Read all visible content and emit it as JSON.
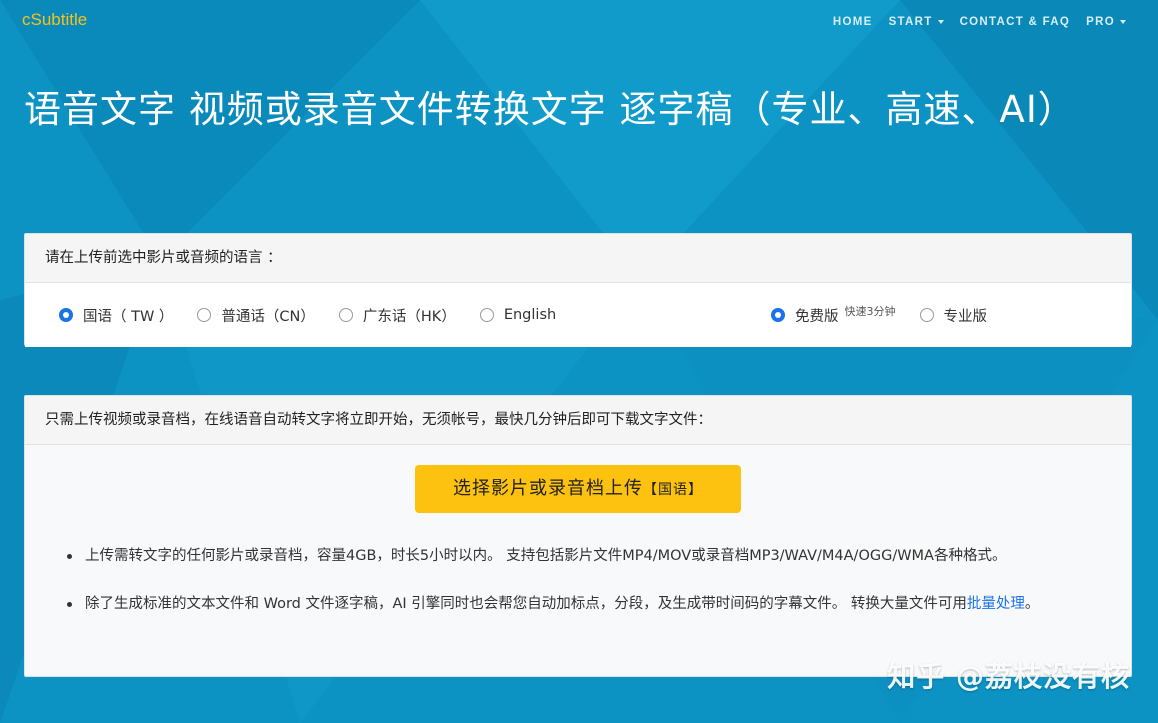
{
  "brand": "cSubtitle",
  "nav": {
    "home": "HOME",
    "start": "START",
    "contact": "CONTACT & FAQ",
    "pro": "PRO"
  },
  "hero": {
    "title": "语音文字 视频或录音文件转换文字 逐字稿（专业、高速、AI）"
  },
  "language_card": {
    "heading": "请在上传前选中影片或音频的语言 ：",
    "languages": [
      {
        "label": "国语（ TW ）",
        "selected": true
      },
      {
        "label": "普通话（CN）",
        "selected": false
      },
      {
        "label": "广东话（HK）",
        "selected": false
      },
      {
        "label": "English",
        "selected": false
      }
    ],
    "plans": [
      {
        "label": "免费版",
        "hint": "快速3分钟",
        "selected": true
      },
      {
        "label": "专业版",
        "selected": false
      }
    ]
  },
  "upload_card": {
    "heading": "只需上传视频或录音档，在线语音自动转文字将立即开始，无须帐号，最快几分钟后即可下载文字文件：",
    "button_label": "选择影片或录音档上传",
    "button_tag": "【国语】",
    "bullet1": "上传需转文字的任何影片或录音档，容量4GB，时长5小时以内。 支持包括影片文件MP4/MOV或录音档MP3/WAV/M4A/OGG/WMA各种格式。",
    "bullet2_text": "除了生成标准的文本文件和 Word 文件逐字稿，AI 引擎同时也会帮您自动加标点，分段，及生成带时间码的字幕文件。 转换大量文件可用",
    "bullet2_link": "批量处理",
    "bullet2_end": "。"
  },
  "watermark": "知乎 @荔枝没有核",
  "colors": {
    "background": "#0c93c4",
    "brand": "#f6c21a",
    "button": "#fdc110",
    "radio_checked": "#1a73e8"
  }
}
